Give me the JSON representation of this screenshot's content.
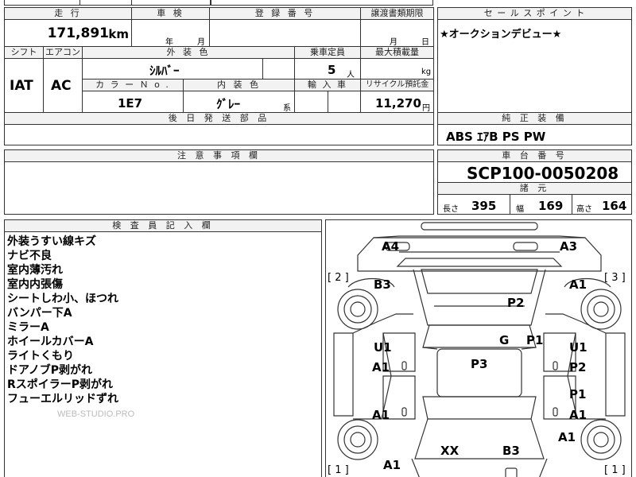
{
  "top_cut": {
    "left": "",
    "mid": "",
    "right": ""
  },
  "mileage": {
    "header": "走 行",
    "value": "171,891",
    "unit": "km"
  },
  "inspection": {
    "header": "車 検",
    "year_label": "年",
    "month_label": "月"
  },
  "registration": {
    "header": "登 録 番 号",
    "value": ""
  },
  "transfer_deadline": {
    "header": "譲渡書類期限",
    "month_label": "月",
    "day_label": "日"
  },
  "sales_point": {
    "header": "セ ー ル ス ポ イ ン ト",
    "text": "★オークションデビュー★"
  },
  "shift": {
    "header": "シフト",
    "value": "IAT"
  },
  "aircon": {
    "header": "エアコン",
    "value": "AC"
  },
  "exterior_color": {
    "header": "外 装 色",
    "value": "ｼﾙﾊﾞｰ"
  },
  "capacity": {
    "header": "乗車定員",
    "value": "5",
    "unit": "人"
  },
  "max_load": {
    "header": "最大積載量",
    "unit": "kg"
  },
  "color_no": {
    "header": "カ ラ ー Ｎ o .",
    "value": "1E7"
  },
  "interior_color": {
    "header": "内 装 色",
    "value": "ｸﾞﾚｰ",
    "suffix": "系"
  },
  "import_car": {
    "header": "輸 入 車"
  },
  "recycle": {
    "header": "リサイクル預託金",
    "value": "11,270",
    "unit": "円"
  },
  "later_parts": {
    "header": "後 日 発 送 部 品"
  },
  "genuine_equipment": {
    "header": "純 正 装 備",
    "value": "ABS ｴｱB PS PW"
  },
  "caution": {
    "header": "注 意 事 項 欄"
  },
  "chassis": {
    "header": "車 台 番 号",
    "value": "SCP100-0050208"
  },
  "specs": {
    "header": "諸 元",
    "length_label": "長さ",
    "length": "395",
    "width_label": "幅",
    "width": "169",
    "height_label": "高さ",
    "height": "164"
  },
  "inspector": {
    "header": "検 査 員 記 入 欄",
    "notes": [
      "外装うすい線キズ",
      "ナビ不良",
      "室内薄汚れ",
      "室内内張傷",
      "シートしわ小、ほつれ",
      "バンパー下A",
      "ミラーA",
      "ホイールカバーA",
      "ライトくもり",
      "ドアノブP剥がれ",
      "RスポイラーP剥がれ",
      "フューエルリッドずれ"
    ],
    "watermark": "WEB-STUDIO.PRO"
  },
  "diagram": {
    "positions": {
      "p2": "[ 2 ]",
      "p3": "[ 3 ]",
      "p1l": "[ 1 ]",
      "p1r": "[ 1 ]"
    },
    "labels": {
      "a4": "A4",
      "a3": "A3",
      "b3_tl": "B3",
      "a1_tr": "A1",
      "p2": "P2",
      "g": "G",
      "p1_c": "P1",
      "u1_l": "U1",
      "u1_r": "U1",
      "a1_l1": "A1",
      "p3": "P3",
      "p2_r": "P2",
      "p1_r": "P1",
      "a1_l2": "A1",
      "a1_r2": "A1",
      "a1_r3": "A1",
      "xx": "XX",
      "b3_b": "B3",
      "a1_b": "A1"
    }
  }
}
